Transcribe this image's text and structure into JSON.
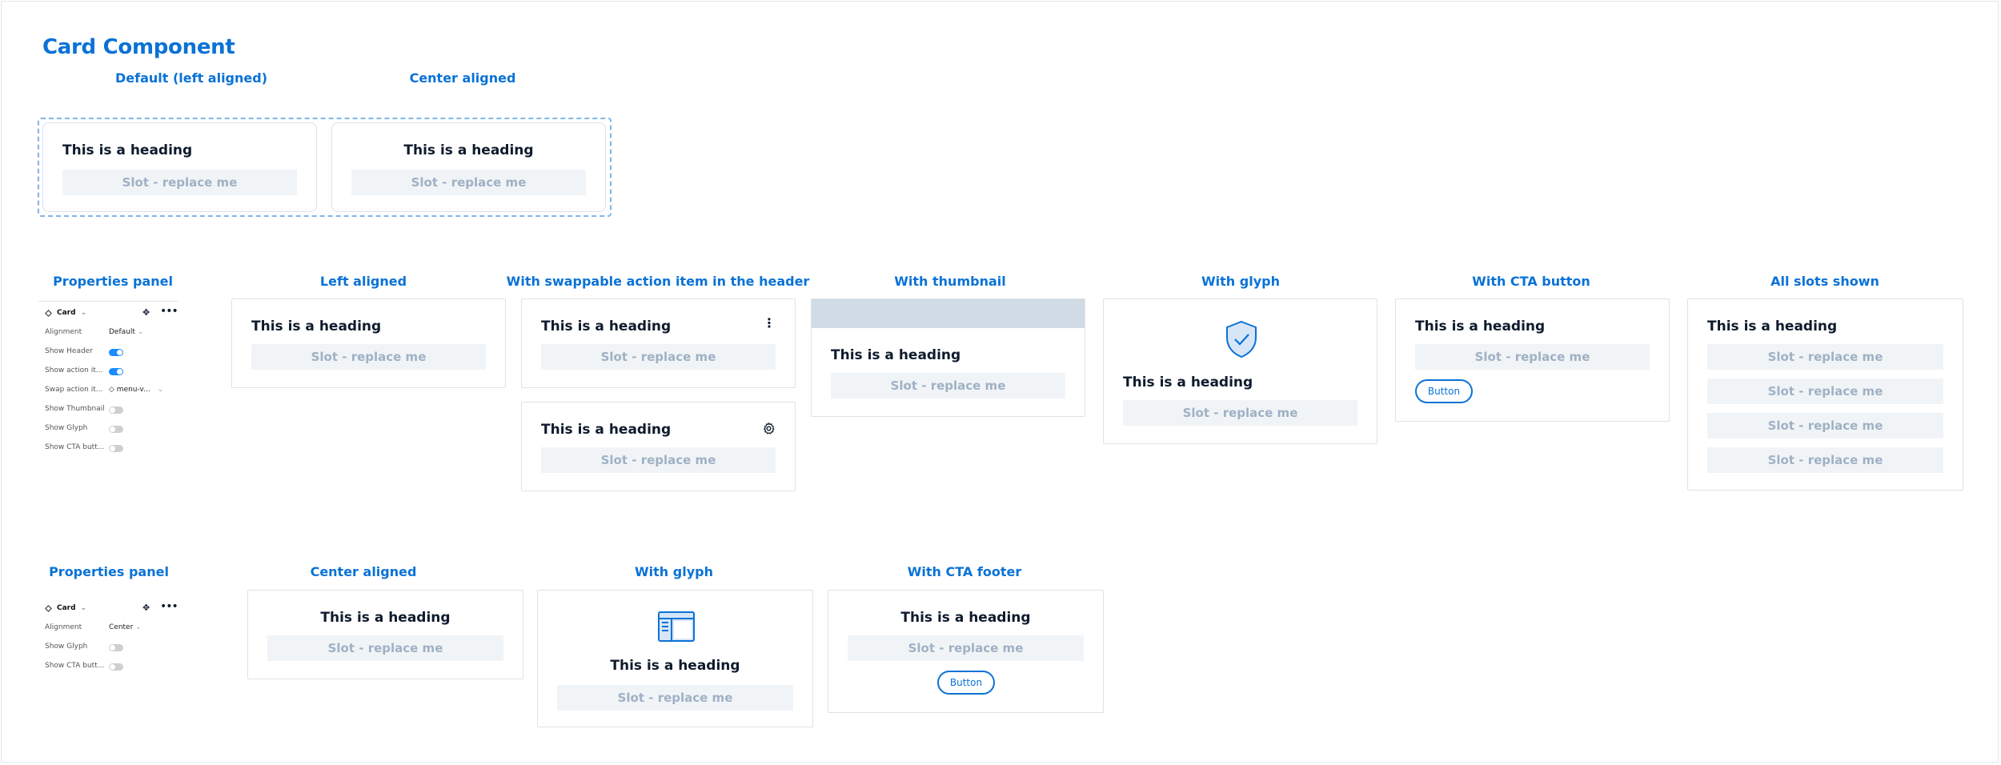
{
  "title": "Card Component",
  "colors": {
    "accent": "#0a72d6",
    "slot_bg": "#f1f4f7",
    "slot_text": "#9fb1c4",
    "thumb": "#d0dbe5",
    "toggle_on": "#1a8cff"
  },
  "top": {
    "default_label": "Default (left aligned)",
    "center_label": "Center aligned",
    "default_card": {
      "heading": "This is a heading",
      "slot": "Slot - replace me"
    },
    "center_card": {
      "heading": "This is a heading",
      "slot": "Slot - replace me"
    }
  },
  "row1": {
    "panel_label": "Properties panel",
    "left_label": "Left aligned",
    "action_label": "With swappable action item in the header",
    "thumb_label": "With thumbnail",
    "glyph_label": "With glyph",
    "cta_label": "With CTA button",
    "slots_label": "All slots shown",
    "heading": "This is a heading",
    "slot": "Slot - replace me",
    "button": "Button",
    "panel": {
      "component": "Card",
      "rows": [
        {
          "label": "Alignment",
          "value": "Default",
          "icon": "chevron-down-icon"
        },
        {
          "label": "Show Header",
          "toggle": true
        },
        {
          "label": "Show action it...",
          "toggle": true
        },
        {
          "label": "Swap action it...",
          "value": "menu-v...",
          "icon": "diamond-icon"
        },
        {
          "label": "Show Thumbnail",
          "toggle": false
        },
        {
          "label": "Show Glyph",
          "toggle": false
        },
        {
          "label": "Show CTA butt...",
          "toggle": false
        }
      ]
    }
  },
  "row2": {
    "panel_label": "Properties panel",
    "center_label": "Center aligned",
    "glyph_label": "With glyph",
    "footer_label": "With CTA footer",
    "heading": "This is a heading",
    "slot": "Slot - replace me",
    "button": "Button",
    "panel": {
      "component": "Card",
      "rows": [
        {
          "label": "Alignment",
          "value": "Center"
        },
        {
          "label": "Show Glyph",
          "toggle": false
        },
        {
          "label": "Show CTA butt...",
          "toggle": false
        }
      ]
    }
  }
}
